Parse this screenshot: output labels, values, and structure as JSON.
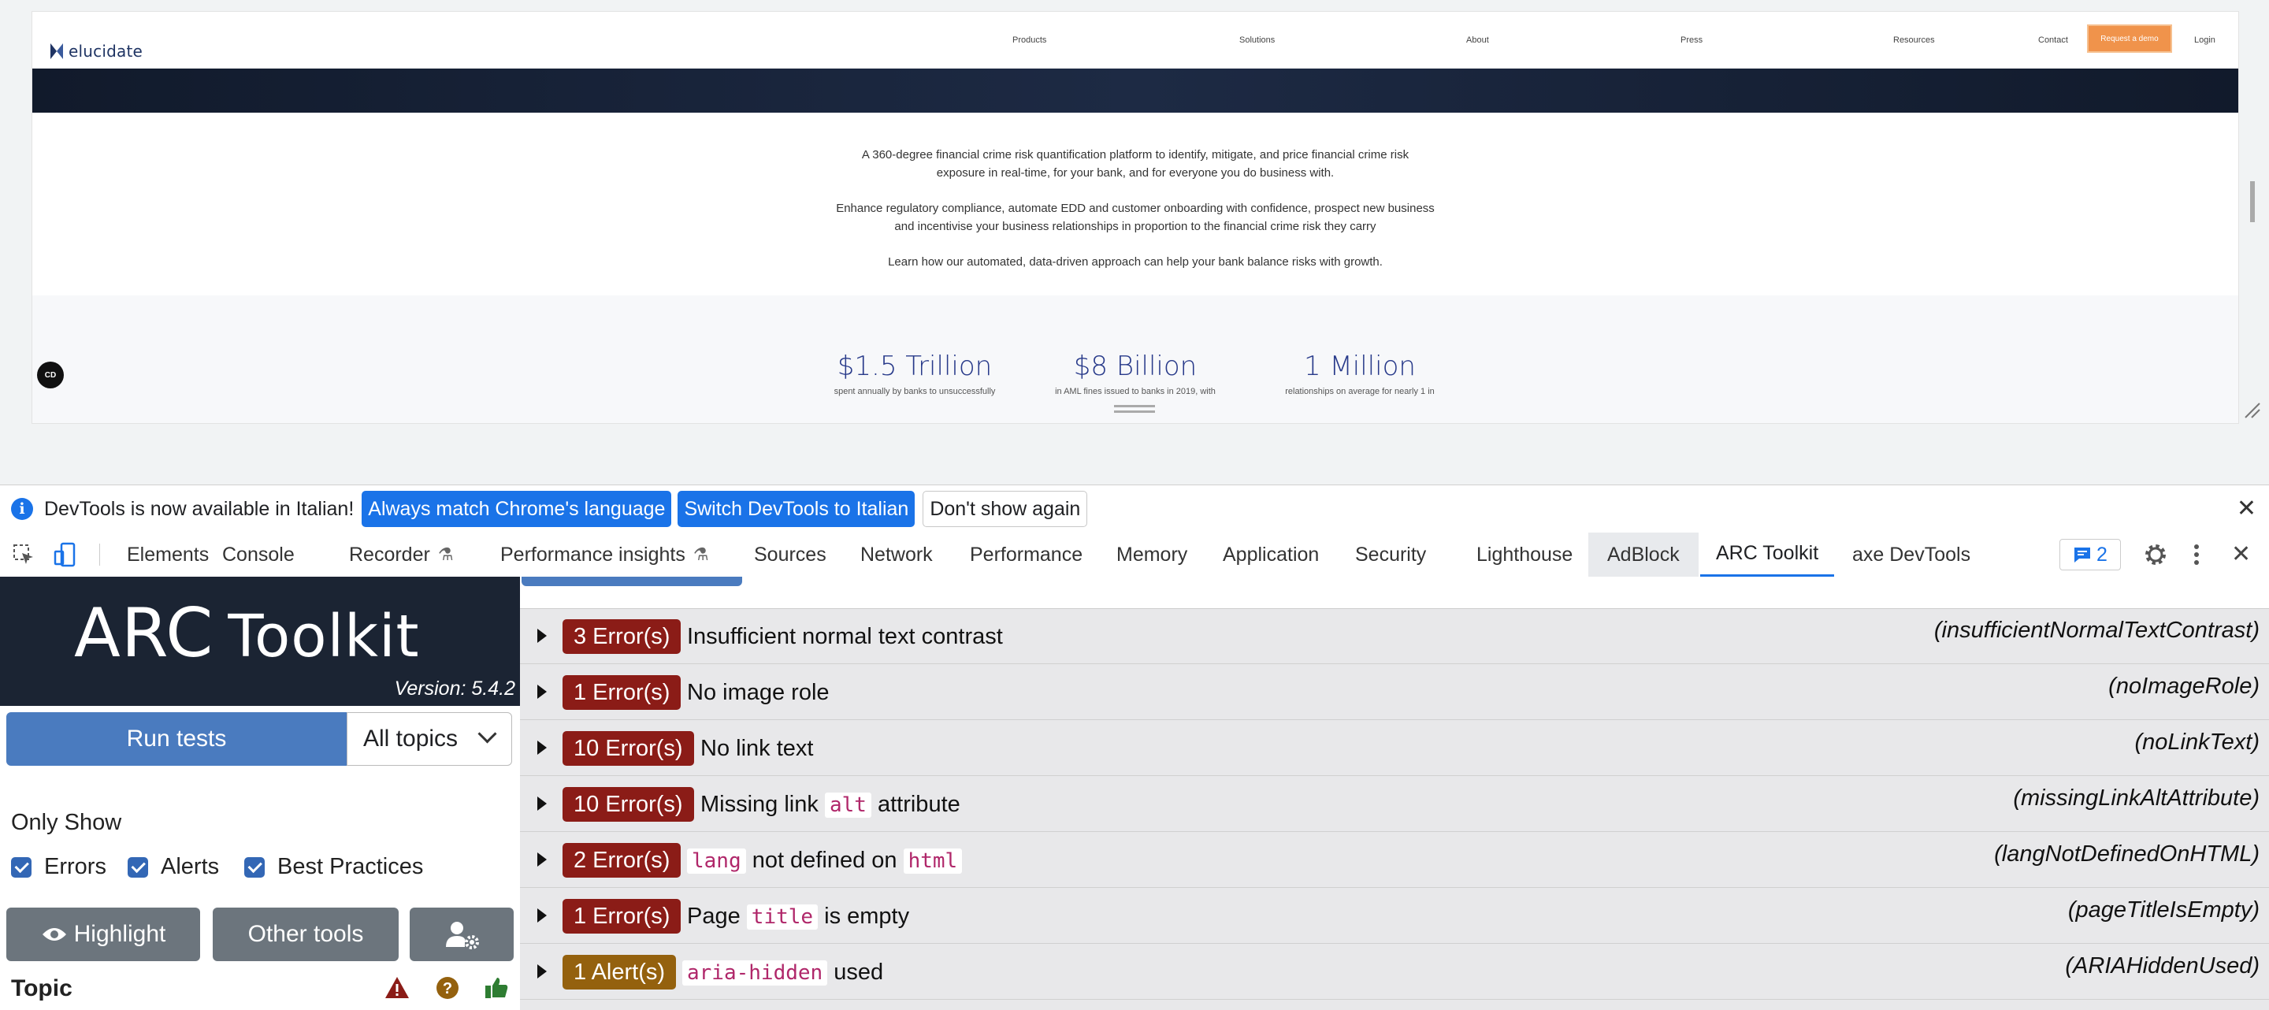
{
  "site": {
    "logo_text": "elucidate",
    "nav": [
      "Products",
      "Solutions",
      "About",
      "Press",
      "Resources",
      "Contact"
    ],
    "cta": "Request a demo",
    "login": "Login",
    "intro_p1_l1": "A 360-degree financial crime risk quantification platform to identify, mitigate, and price financial crime risk",
    "intro_p1_l2": "exposure in real-time, for your bank, and for everyone you do business with.",
    "intro_p2_l1": "Enhance regulatory compliance, automate EDD and customer onboarding with confidence, prospect new business",
    "intro_p2_l2": "and incentivise your business relationships in proportion to the financial crime risk they carry",
    "intro_p3": "Learn how our automated, data-driven approach can help your bank balance risks with growth.",
    "stats": [
      {
        "value": "$1.5 Trillion",
        "caption": "spent annually by banks to unsuccessfully"
      },
      {
        "value": "$8 Billion",
        "caption": "in AML fines issued to banks in 2019, with"
      },
      {
        "value": "1 Million",
        "caption": "relationships on average for nearly 1 in"
      }
    ],
    "cc_badge": "CD"
  },
  "infobar": {
    "icon": "i",
    "message": "DevTools is now available in Italian!",
    "btn_match": "Always match Chrome's language",
    "btn_switch": "Switch DevTools to Italian",
    "btn_dismiss": "Don't show again"
  },
  "tabs": {
    "elements": "Elements",
    "console": "Console",
    "recorder": "Recorder",
    "perf_insights": "Performance insights",
    "sources": "Sources",
    "network": "Network",
    "performance": "Performance",
    "memory": "Memory",
    "application": "Application",
    "security": "Security",
    "lighthouse": "Lighthouse",
    "adblock": "AdBlock",
    "arc": "ARC Toolkit",
    "axe": "axe DevTools",
    "message_count": "2"
  },
  "arc": {
    "title_arc": "ARC",
    "title_toolkit": "Toolkit",
    "version": "Version: 5.4.2",
    "run_tests": "Run tests",
    "topic_select": "All topics",
    "only_show": "Only Show",
    "filters": [
      "Errors",
      "Alerts",
      "Best Practices"
    ],
    "highlight": "Highlight",
    "other_tools": "Other tools",
    "topic": "Topic"
  },
  "results": [
    {
      "badge": "3 Error(s)",
      "type": "error",
      "pre": "Insufficient normal text contrast",
      "code1": "",
      "mid": "",
      "code2": "",
      "post": "",
      "id": "(insufficientNormalTextContrast)"
    },
    {
      "badge": "1 Error(s)",
      "type": "error",
      "pre": "No image role",
      "code1": "",
      "mid": "",
      "code2": "",
      "post": "",
      "id": "(noImageRole)"
    },
    {
      "badge": "10 Error(s)",
      "type": "error",
      "pre": "No link text",
      "code1": "",
      "mid": "",
      "code2": "",
      "post": "",
      "id": "(noLinkText)"
    },
    {
      "badge": "10 Error(s)",
      "type": "error",
      "pre": "Missing link",
      "code1": "alt",
      "mid": "attribute",
      "code2": "",
      "post": "",
      "id": "(missingLinkAltAttribute)"
    },
    {
      "badge": "2 Error(s)",
      "type": "error",
      "pre": "",
      "code1": "lang",
      "mid": "not defined on",
      "code2": "html",
      "post": "",
      "id": "(langNotDefinedOnHTML)"
    },
    {
      "badge": "1 Error(s)",
      "type": "error",
      "pre": "Page",
      "code1": "title",
      "mid": "is empty",
      "code2": "",
      "post": "",
      "id": "(pageTitleIsEmpty)"
    },
    {
      "badge": "1 Alert(s)",
      "type": "alert",
      "pre": "",
      "code1": "aria-hidden",
      "mid": "used",
      "code2": "",
      "post": "",
      "id": "(ARIAHiddenUsed)"
    }
  ],
  "colors": {
    "error_badge": "#8b1c17",
    "alert_badge": "#94610e",
    "accent": "#1a73e8",
    "cta": "#f0934b"
  }
}
